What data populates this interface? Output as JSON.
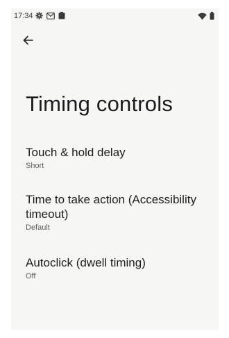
{
  "status_bar": {
    "time": "17:34",
    "left_icons": [
      "settings-gear-icon",
      "gmail-icon",
      "clipboard-icon"
    ],
    "right_icons": [
      "wifi-icon",
      "battery-icon"
    ]
  },
  "header": {
    "back_icon": "arrow-left-icon",
    "title": "Timing controls"
  },
  "settings": [
    {
      "title": "Touch & hold delay",
      "summary": "Short"
    },
    {
      "title": "Time to take action (Accessibility timeout)",
      "summary": "Default"
    },
    {
      "title": "Autoclick (dwell timing)",
      "summary": "Off"
    }
  ],
  "colors": {
    "background": "#f6f6f5",
    "text_primary": "#1c1c1c",
    "text_secondary": "#5c5c5c"
  }
}
